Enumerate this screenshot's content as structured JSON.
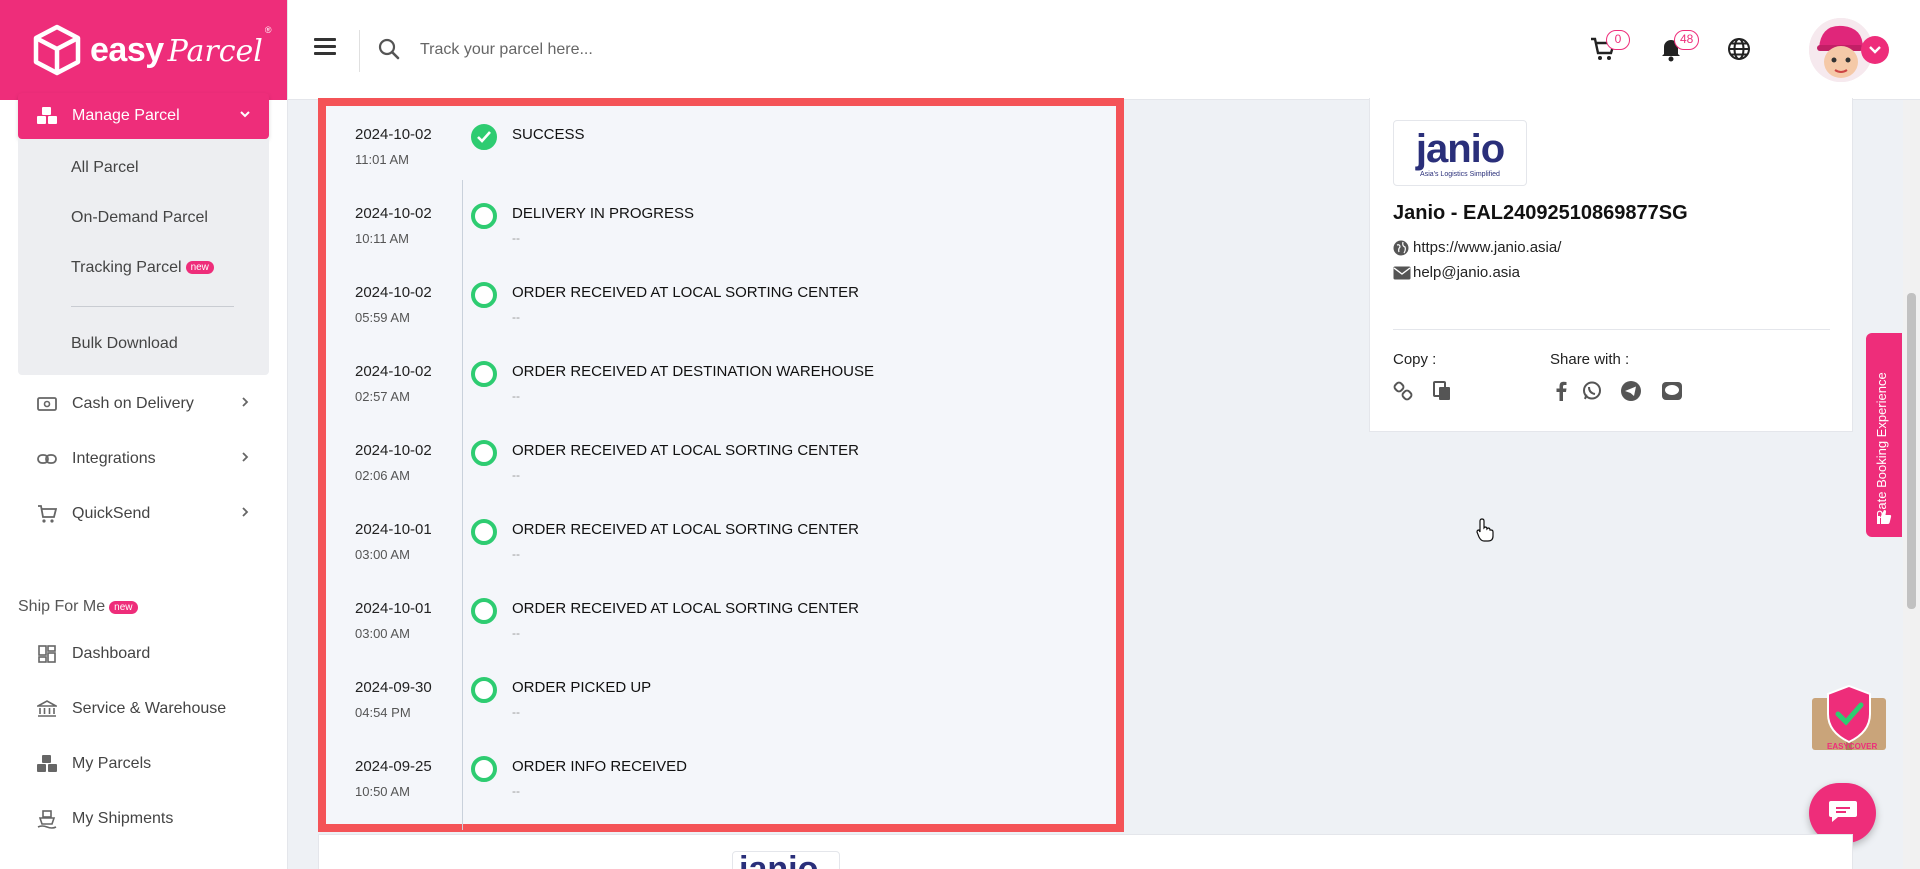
{
  "brand": {
    "name_part1": "easy",
    "name_part2": "Parcel",
    "reg": "®"
  },
  "sidebar": {
    "active_menu": "Manage Parcel",
    "submenu": [
      {
        "label": "All Parcel"
      },
      {
        "label": "On-Demand Parcel"
      },
      {
        "label": "Tracking Parcel",
        "badge": "new"
      },
      {
        "label": "Bulk Download"
      }
    ],
    "nav": [
      {
        "label": "Cash on Delivery",
        "icon": "cash-icon"
      },
      {
        "label": "Integrations",
        "icon": "link-icon"
      },
      {
        "label": "QuickSend",
        "icon": "cart-plus-icon"
      }
    ],
    "section": {
      "label": "Ship For Me",
      "badge": "new"
    },
    "ship_items": [
      {
        "label": "Dashboard",
        "icon": "dashboard-icon"
      },
      {
        "label": "Service & Warehouse",
        "icon": "bank-icon"
      },
      {
        "label": "My Parcels",
        "icon": "boxes-icon"
      },
      {
        "label": "My Shipments",
        "icon": "ship-icon"
      }
    ]
  },
  "header": {
    "search_placeholder": "Track your parcel here...",
    "cart_count": "0",
    "notif_count": "48",
    "icons": [
      "menu-icon",
      "search-icon",
      "cart-icon",
      "bell-icon",
      "globe-icon"
    ]
  },
  "timeline": [
    {
      "date": "2024-10-02",
      "time": "11:01 AM",
      "status": "SUCCESS",
      "sub": "",
      "done": true
    },
    {
      "date": "2024-10-02",
      "time": "10:11 AM",
      "status": "DELIVERY IN PROGRESS",
      "sub": "--",
      "done": false
    },
    {
      "date": "2024-10-02",
      "time": "05:59 AM",
      "status": "ORDER RECEIVED AT LOCAL SORTING CENTER",
      "sub": "--",
      "done": false
    },
    {
      "date": "2024-10-02",
      "time": "02:57 AM",
      "status": "ORDER RECEIVED AT DESTINATION WAREHOUSE",
      "sub": "--",
      "done": false
    },
    {
      "date": "2024-10-02",
      "time": "02:06 AM",
      "status": "ORDER RECEIVED AT LOCAL SORTING CENTER",
      "sub": "--",
      "done": false
    },
    {
      "date": "2024-10-01",
      "time": "03:00 AM",
      "status": "ORDER RECEIVED AT LOCAL SORTING CENTER",
      "sub": "--",
      "done": false
    },
    {
      "date": "2024-10-01",
      "time": "03:00 AM",
      "status": "ORDER RECEIVED AT LOCAL SORTING CENTER",
      "sub": "--",
      "done": false
    },
    {
      "date": "2024-09-30",
      "time": "04:54 PM",
      "status": "ORDER PICKED UP",
      "sub": "--",
      "done": false
    },
    {
      "date": "2024-09-25",
      "time": "10:50 AM",
      "status": "ORDER INFO RECEIVED",
      "sub": "--",
      "done": false
    }
  ],
  "courier": {
    "logo_word": "janio",
    "logo_tagline": "Asia's Logistics Simplified",
    "title": "Janio - EAL24092510869877SG",
    "website": "https://www.janio.asia/",
    "email": "help@janio.asia",
    "copy_label": "Copy :",
    "share_label": "Share with :",
    "share_icons": [
      "facebook-icon",
      "whatsapp-icon",
      "telegram-icon",
      "line-icon"
    ]
  },
  "rate_tab": "Rate Booking Experience",
  "easycover_label": "EASYCOVER",
  "bottom_logo_word": "janio",
  "colors": {
    "brand": "#ee2d7a",
    "success": "#2ecc71",
    "highlight": "#f45357"
  }
}
